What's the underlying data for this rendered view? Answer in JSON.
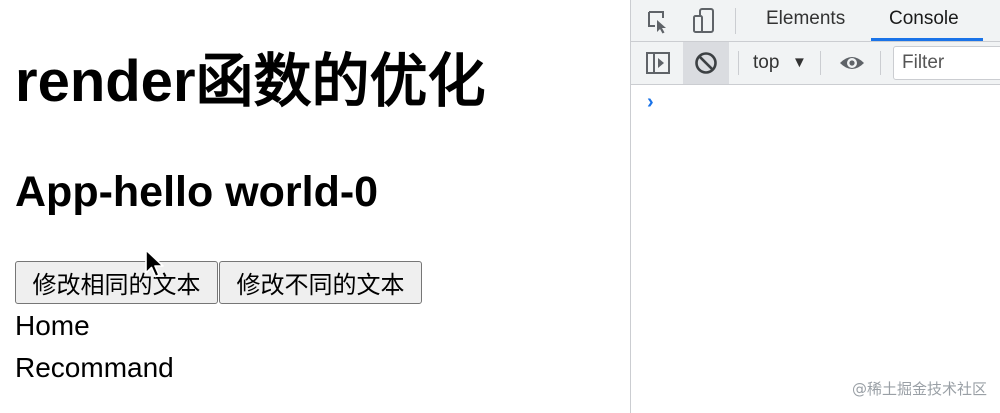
{
  "page": {
    "title": "render函数的优化",
    "app_heading": "App-hello world-0",
    "buttons": {
      "modify_same": "修改相同的文本",
      "modify_different": "修改不同的文本"
    },
    "links": {
      "home": "Home",
      "recommand": "Recommand"
    }
  },
  "devtools": {
    "tabs": {
      "elements": "Elements",
      "console": "Console"
    },
    "active_tab": "Console",
    "toolbar": {
      "context": "top",
      "context_arrow": "▼",
      "filter_placeholder": "Filter"
    },
    "console": {
      "prompt": "›"
    },
    "colors": {
      "accent": "#1a73e8",
      "toolbar_bg": "#f1f3f4"
    }
  },
  "watermark": "@稀土掘金技术社区"
}
